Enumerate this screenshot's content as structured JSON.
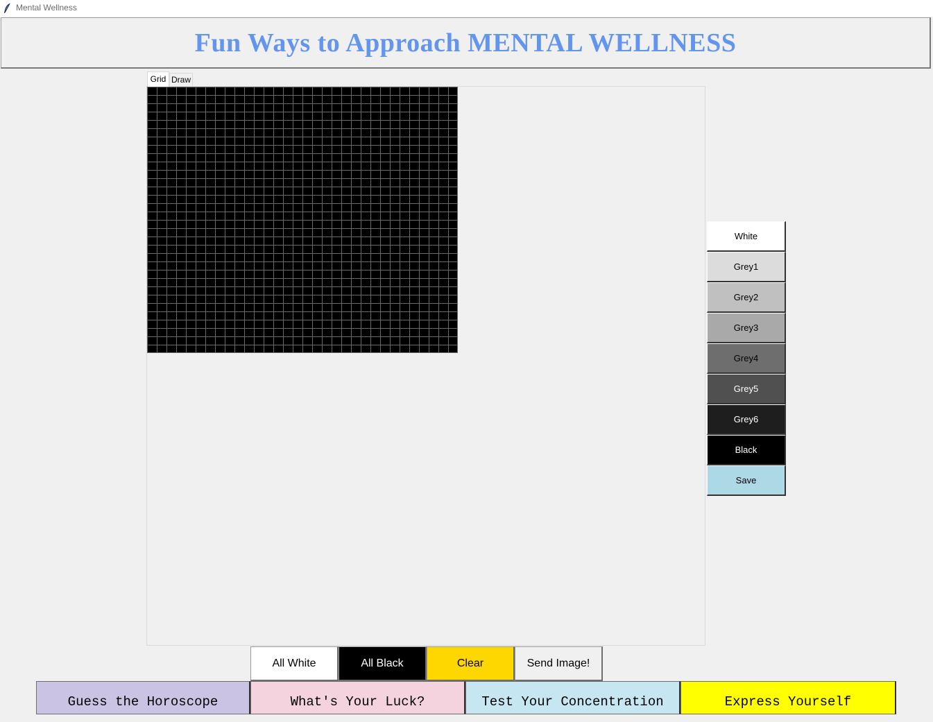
{
  "window": {
    "title": "Mental Wellness",
    "icon": "feather-icon"
  },
  "header": {
    "title": "Fun Ways to Approach MENTAL WELLNESS",
    "color": "#6495ed"
  },
  "tabs": [
    {
      "label": "Grid",
      "selected": true
    },
    {
      "label": "Draw",
      "selected": false
    }
  ],
  "grid": {
    "columns": 32,
    "rows": 32,
    "fill_color": "#000000",
    "line_color": "#6a6a6a"
  },
  "palette": [
    {
      "label": "White",
      "bg": "#ffffff",
      "fg": "#000000"
    },
    {
      "label": "Grey1",
      "bg": "#dcdcdc",
      "fg": "#000000"
    },
    {
      "label": "Grey2",
      "bg": "#c0c0c0",
      "fg": "#000000"
    },
    {
      "label": "Grey3",
      "bg": "#a9a9a9",
      "fg": "#000000"
    },
    {
      "label": "Grey4",
      "bg": "#6e6e6e",
      "fg": "#000000"
    },
    {
      "label": "Grey5",
      "bg": "#505050",
      "fg": "#ffffff"
    },
    {
      "label": "Grey6",
      "bg": "#1e1e1e",
      "fg": "#ffffff"
    },
    {
      "label": "Black",
      "bg": "#000000",
      "fg": "#ffffff"
    },
    {
      "label": "Save",
      "bg": "#add8e6",
      "fg": "#000000"
    }
  ],
  "actions": [
    {
      "label": "All White",
      "bg": "#ffffff",
      "fg": "#000000"
    },
    {
      "label": "All Black",
      "bg": "#000000",
      "fg": "#ffffff"
    },
    {
      "label": "Clear",
      "bg": "#ffd700",
      "fg": "#000000"
    },
    {
      "label": "Send Image!",
      "bg": "#f0f0f0",
      "fg": "#000000"
    }
  ],
  "nav": [
    {
      "label": "Guess the Horoscope",
      "bg": "#cbc3e3"
    },
    {
      "label": "What's Your Luck?",
      "bg": "#f4d3df"
    },
    {
      "label": "Test Your Concentration",
      "bg": "#c6e7f2"
    },
    {
      "label": "Express Yourself",
      "bg": "#ffff00"
    }
  ]
}
